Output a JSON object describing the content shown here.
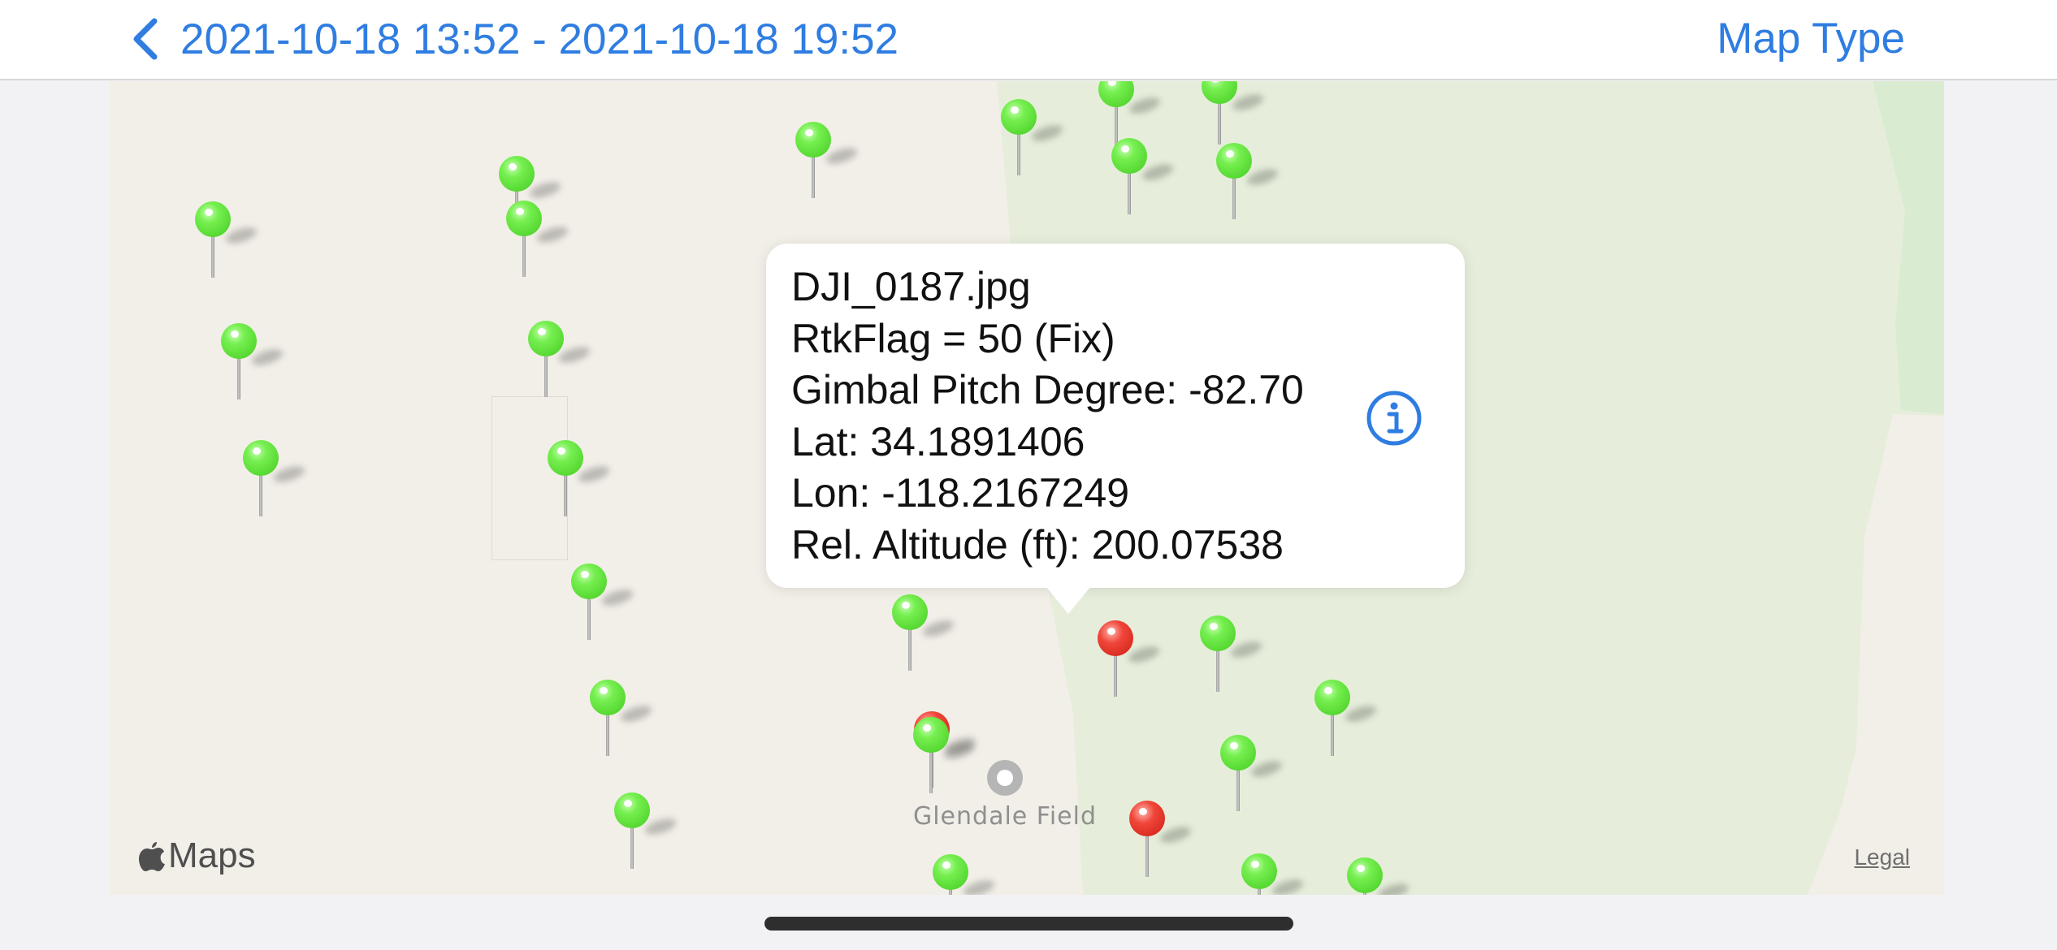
{
  "navbar": {
    "back_icon": "chevron-left-icon",
    "title": "2021-10-18 13:52 - 2021-10-18 19:52",
    "map_type_label": "Map Type",
    "accent_color": "#2f7de1"
  },
  "map": {
    "poi_label": "Glendale Field",
    "poi_icon": "point-of-interest-icon",
    "attribution_logo": "apple-icon",
    "attribution_text": "Maps",
    "legal_label": "Legal",
    "pin_colors": {
      "green": "#52d52e",
      "red": "#d82a20"
    }
  },
  "callout": {
    "filename": "DJI_0187.jpg",
    "rtk_flag": "RtkFlag = 50 (Fix)",
    "gimbal_pitch": "Gimbal Pitch Degree: -82.70",
    "lat": "Lat: 34.1891406",
    "lon": "Lon: -118.2167249",
    "rel_altitude": "Rel. Altitude (ft): 200.07538",
    "info_icon": "info-icon"
  }
}
